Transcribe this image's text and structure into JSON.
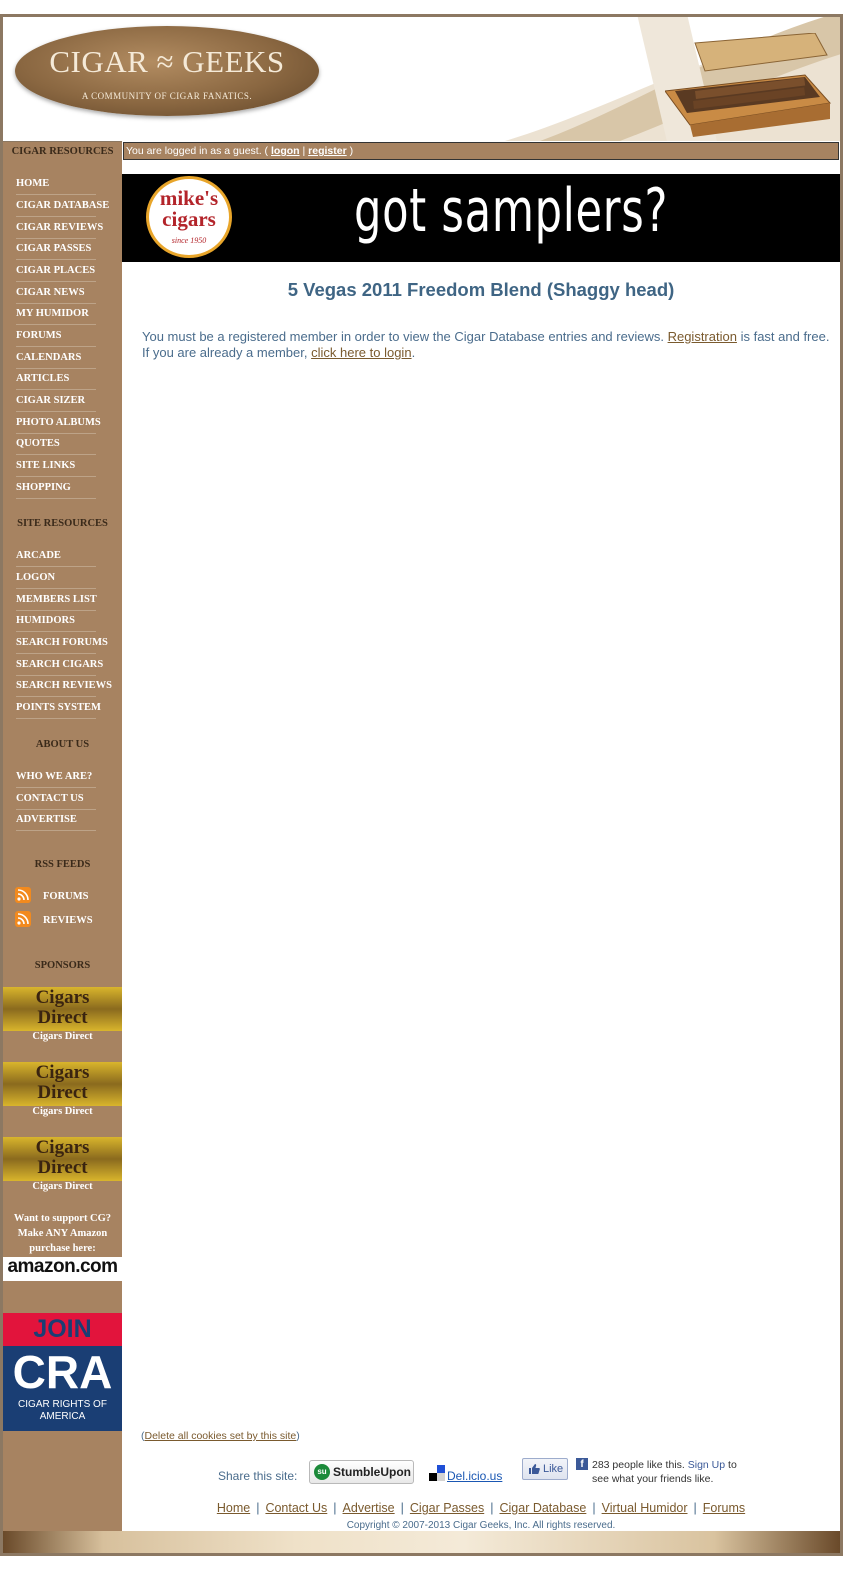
{
  "header": {
    "logo_title": "CIGAR ≈ GEEKS",
    "logo_tagline": "A COMMUNITY OF CIGAR FANATICS."
  },
  "sidebar": {
    "cigar_resources_heading": "CIGAR RESOURCES",
    "cigar_links": [
      "HOME",
      "CIGAR DATABASE",
      "CIGAR REVIEWS",
      "CIGAR PASSES",
      "CIGAR PLACES",
      "CIGAR NEWS",
      "MY HUMIDOR",
      "FORUMS",
      "CALENDARS",
      "ARTICLES",
      "CIGAR SIZER",
      "PHOTO ALBUMS",
      "QUOTES",
      "SITE LINKS",
      "SHOPPING"
    ],
    "site_resources_heading": "SITE RESOURCES",
    "site_links": [
      "ARCADE",
      "LOGON",
      "MEMBERS LIST",
      "HUMIDORS",
      "SEARCH FORUMS",
      "SEARCH CIGARS",
      "SEARCH REVIEWS",
      "POINTS SYSTEM"
    ],
    "about_heading": "ABOUT US",
    "about_links": [
      "WHO WE ARE?",
      "CONTACT US",
      "ADVERTISE"
    ],
    "rss_heading": "RSS FEEDS",
    "rss_links": [
      "FORUMS",
      "REVIEWS"
    ],
    "sponsors_heading": "SPONSORS",
    "sponsor_banner_text": [
      "Cigars",
      "Direct"
    ],
    "sponsors": [
      "Cigars Direct",
      "Cigars Direct",
      "Cigars Direct"
    ],
    "amazon_text": "Want to support CG? Make ANY Amazon purchase here:",
    "amazon_logo": "amazon.com",
    "cra_join": "JOIN",
    "cra_word": "CRA",
    "cra_sub": "CIGAR RIGHTS OF AMERICA"
  },
  "guestbar": {
    "prefix": "You are logged in as a guest. (",
    "logon": "logon",
    "divider": "|",
    "register": "register",
    "suffix": ")"
  },
  "banner": {
    "brand": "mike's cigars",
    "since": "since 1950",
    "slogan": "got samplers?"
  },
  "main": {
    "cigar_title": "5 Vegas 2011 Freedom Blend (Shaggy head)",
    "notice_1": "You must be a registered member in order to view the Cigar Database entries and reviews.",
    "notice_link_1": "Registration",
    "notice_2": "is fast and free. If you are already a member,",
    "notice_link_2": "click here to login",
    "notice_3": "."
  },
  "footer": {
    "cookies_open": "(",
    "cookies_link": "Delete all cookies set by this site",
    "cookies_close": ")",
    "share_label": "Share this site:",
    "stumble_label": "StumbleUpon",
    "delicious_label": "Del.icio.us",
    "fb_like": "Like",
    "fb_text_1": "283 people like this.",
    "fb_signup": "Sign Up",
    "fb_text_2": "to see what your friends like.",
    "nav": [
      "Home",
      "Contact Us",
      "Advertise",
      "Cigar Passes",
      "Cigar Database",
      "Virtual Humidor",
      "Forums"
    ],
    "copyright": "Copyright © 2007-2013 Cigar Geeks, Inc. All rights reserved."
  },
  "colors": {
    "sidebar_bg": "#a78361",
    "link_brown": "#7a5a2e",
    "title_blue": "#3f6584",
    "text_blue": "#4a6c8c"
  }
}
